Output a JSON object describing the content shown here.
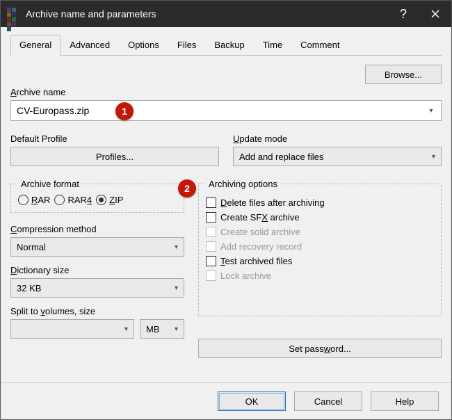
{
  "window": {
    "title": "Archive name and parameters"
  },
  "tabs": [
    "General",
    "Advanced",
    "Options",
    "Files",
    "Backup",
    "Time",
    "Comment"
  ],
  "activeTab": "General",
  "browseBtn": "Browse...",
  "archiveName": {
    "label": "Archive name",
    "value": "CV-Europass.zip"
  },
  "defaultProfile": {
    "label": "Default Profile",
    "button": "Profiles..."
  },
  "updateMode": {
    "label": "Update mode",
    "value": "Add and replace files"
  },
  "archiveFormat": {
    "label": "Archive format",
    "options": [
      "RAR",
      "RAR4",
      "ZIP"
    ],
    "selected": "ZIP"
  },
  "compression": {
    "label": "Compression method",
    "value": "Normal"
  },
  "dictionary": {
    "label": "Dictionary size",
    "value": "32 KB"
  },
  "split": {
    "label": "Split to volumes, size",
    "value": "",
    "unit": "MB"
  },
  "archOptions": {
    "label": "Archiving options",
    "items": [
      {
        "label": "Delete files after archiving",
        "checked": false,
        "disabled": false,
        "accel": "D"
      },
      {
        "label": "Create SFX archive",
        "checked": false,
        "disabled": false,
        "accel": "X"
      },
      {
        "label": "Create solid archive",
        "checked": false,
        "disabled": true,
        "accel": ""
      },
      {
        "label": "Add recovery record",
        "checked": false,
        "disabled": true,
        "accel": ""
      },
      {
        "label": "Test archived files",
        "checked": false,
        "disabled": false,
        "accel": "T"
      },
      {
        "label": "Lock archive",
        "checked": false,
        "disabled": true,
        "accel": ""
      }
    ]
  },
  "setPassword": "Set password...",
  "footer": {
    "ok": "OK",
    "cancel": "Cancel",
    "help": "Help"
  },
  "callouts": {
    "c1": "1",
    "c2": "2"
  }
}
